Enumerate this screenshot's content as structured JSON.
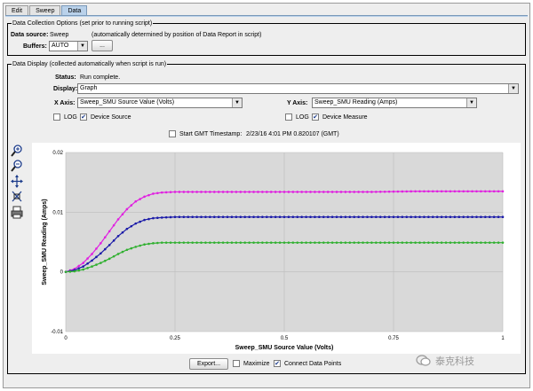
{
  "tabs": [
    "Edit",
    "Sweep",
    "Data"
  ],
  "collection": {
    "title": "Data Collection Options (set prior to running script)",
    "source_label": "Data source:",
    "source_value": "Sweep",
    "source_note": "(automatically determined by position of Data Report in script)",
    "buffers_label": "Buffers:",
    "buffers_value": "AUTO",
    "buffers_button": "..."
  },
  "display": {
    "title": "Data Display (collected automatically when script is run)",
    "status_label": "Status:",
    "status_value": "Run complete.",
    "display_label": "Display:",
    "display_value": "Graph",
    "xaxis_label": "X Axis:",
    "xaxis_value": "Sweep_SMU Source Value (Volts)",
    "yaxis_label": "Y Axis:",
    "yaxis_value": "Sweep_SMU Reading (Amps)",
    "log_label": "LOG",
    "device_source_label": "Device Source",
    "device_measure_label": "Device Measure",
    "timestamp_label": "Start GMT Timestamp:",
    "timestamp_value": "2/23/16 4:01 PM 0.820107 (GMT)"
  },
  "toolbar_icons": [
    "zoom-in-icon",
    "zoom-out-icon",
    "pan-icon",
    "fit-icon",
    "print-icon"
  ],
  "footer": {
    "export_label": "Export...",
    "maximize_label": "Maximize",
    "connect_label": "Connect Data Points"
  },
  "watermark_text": "泰克科技",
  "colors": {
    "tab_active": "#b9d1ea",
    "plot_bg": "#d9d9d9",
    "series_magenta": "#e020e0",
    "series_blue": "#1a1aa8",
    "series_green": "#30b030"
  },
  "chart_data": {
    "type": "line",
    "xlabel": "Sweep_SMU Source Value (Volts)",
    "ylabel": "Sweep_SMU Reading (Amps)",
    "xlim": [
      0,
      1
    ],
    "ylim": [
      -0.01,
      0.02
    ],
    "x_ticks": [
      "0",
      "0.25",
      "0.5",
      "0.75",
      "1"
    ],
    "y_ticks": [
      "-0.01",
      "0",
      "0.01",
      "0.02"
    ],
    "x_tick_values": [
      0,
      0.25,
      0.5,
      0.75,
      1
    ],
    "y_tick_values": [
      -0.01,
      0,
      0.01,
      0.02
    ],
    "grid": true,
    "x": [
      0,
      0.02,
      0.04,
      0.06,
      0.08,
      0.1,
      0.12,
      0.14,
      0.16,
      0.18,
      0.2,
      0.22,
      0.25,
      0.3,
      0.4,
      0.5,
      0.6,
      0.7,
      0.8,
      0.9,
      1.0
    ],
    "series": [
      {
        "color": "#e020e0",
        "values": [
          0,
          0.0005,
          0.0015,
          0.003,
          0.0048,
          0.0068,
          0.0088,
          0.0105,
          0.0118,
          0.0126,
          0.0131,
          0.0133,
          0.0134,
          0.0134,
          0.0134,
          0.0134,
          0.0134,
          0.0134,
          0.0135,
          0.0135,
          0.0135
        ]
      },
      {
        "color": "#1a1aa8",
        "values": [
          0,
          0.0003,
          0.0009,
          0.0019,
          0.0031,
          0.0045,
          0.006,
          0.0072,
          0.0081,
          0.0087,
          0.009,
          0.0091,
          0.0092,
          0.0092,
          0.0092,
          0.0092,
          0.0092,
          0.0092,
          0.0092,
          0.0092,
          0.0092
        ]
      },
      {
        "color": "#30b030",
        "values": [
          0,
          0.0001,
          0.0004,
          0.0009,
          0.0015,
          0.0022,
          0.003,
          0.0037,
          0.0042,
          0.0046,
          0.0048,
          0.0049,
          0.0049,
          0.0049,
          0.0049,
          0.0049,
          0.0049,
          0.0049,
          0.0049,
          0.0049,
          0.0049
        ]
      }
    ]
  }
}
